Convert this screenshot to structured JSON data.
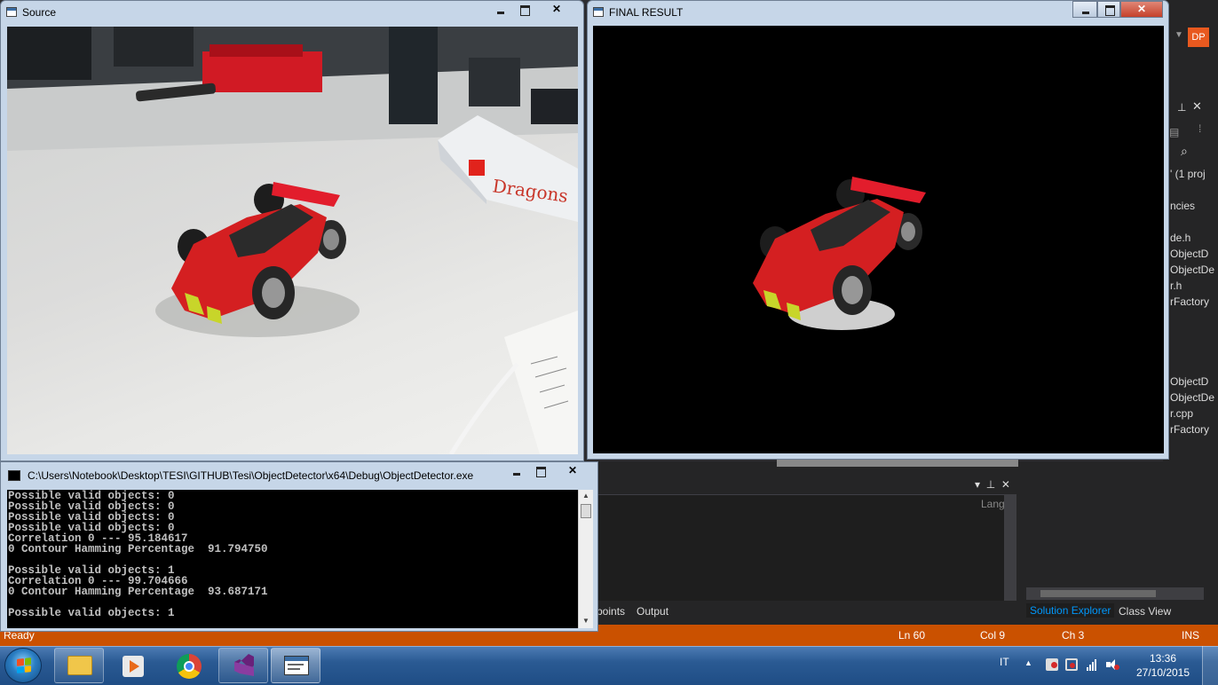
{
  "vs": {
    "account_initials": "DP",
    "solution_explorer_fragments": [
      "' (1 proj",
      "ncies",
      "de.h",
      "ObjectD",
      "ObjectDe",
      "r.h",
      "rFactory",
      "ObjectD",
      "ObjectDe",
      "r.cpp",
      "rFactory"
    ],
    "output_panel": {
      "lang_label": "Lang",
      "tab_breakpoints": "points",
      "tab_output": "Output"
    },
    "solution_tabs": {
      "solution_explorer": "Solution Explorer",
      "class_view": "Class View"
    },
    "statusbar": {
      "ready": "Ready",
      "line": "Ln 60",
      "col": "Col 9",
      "ch": "Ch 3",
      "ins": "INS"
    },
    "colors": {
      "statusbar": "#ca5100",
      "accent": "#0097fb"
    }
  },
  "windows": {
    "source": {
      "title": "Source"
    },
    "final": {
      "title": "FINAL RESULT"
    },
    "console": {
      "title": "C:\\Users\\Notebook\\Desktop\\TESI\\GITHUB\\Tesi\\ObjectDetector\\x64\\Debug\\ObjectDetector.exe",
      "lines": [
        "Possible valid objects: 0",
        "Possible valid objects: 0",
        "Possible valid objects: 0",
        "Possible valid objects: 0",
        "Correlation 0 --- 95.184617",
        "0 Contour Hamming Percentage  91.794750",
        "",
        "Possible valid objects: 1",
        "Correlation 0 --- 99.704666",
        "0 Contour Hamming Percentage  93.687171",
        "",
        "Possible valid objects: 1"
      ]
    }
  },
  "taskbar": {
    "apps": [
      "file-explorer",
      "media-player",
      "chrome",
      "visual-studio",
      "console-window"
    ],
    "language": "IT",
    "time": "13:36",
    "date": "27/10/2015"
  }
}
